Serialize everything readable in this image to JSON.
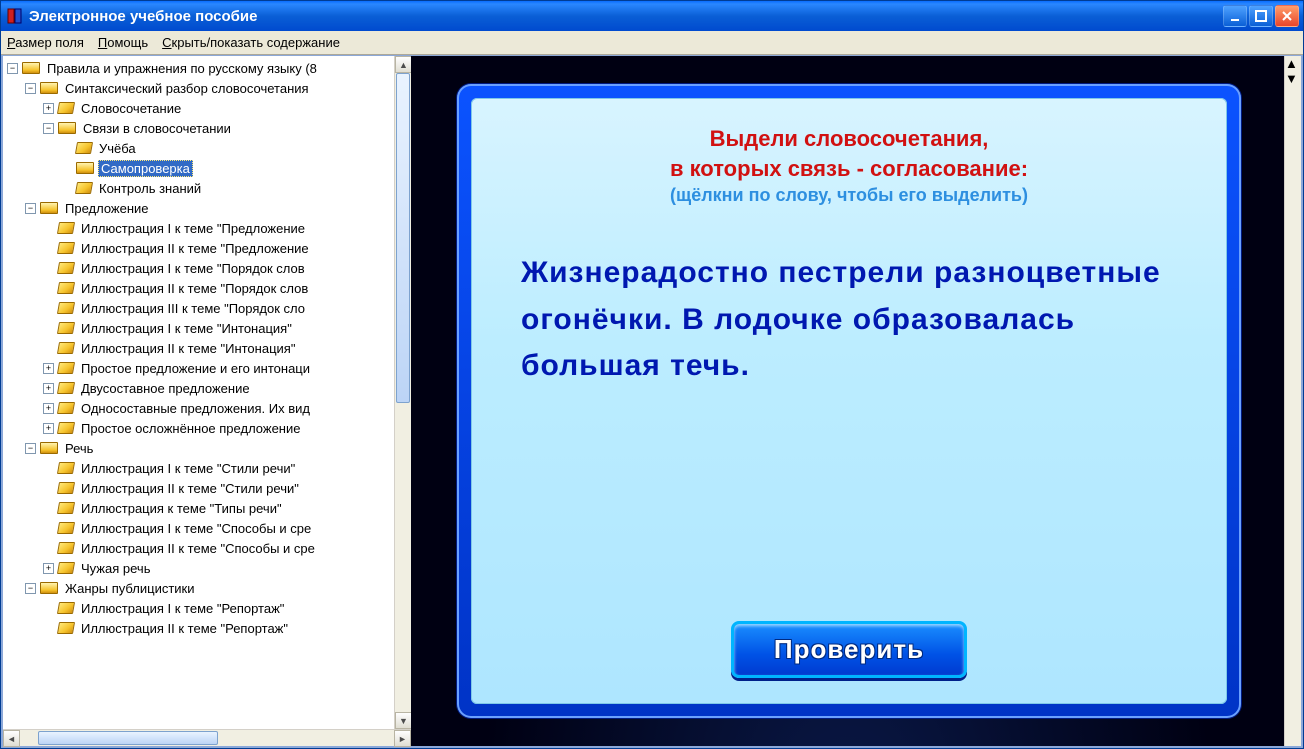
{
  "window": {
    "title": "Электронное учебное пособие"
  },
  "menu": {
    "field_size": "Размер поля",
    "help": "Помощь",
    "toggle_toc": "Скрыть/показать содержание"
  },
  "tree": {
    "root": {
      "label": "Правила и упражнения по русскому языку (8",
      "toggle": "−"
    },
    "syntax": {
      "label": "Синтаксический разбор словосочетания",
      "toggle": "−"
    },
    "slovosoch": {
      "label": "Словосочетание"
    },
    "svyazi": {
      "label": "Связи в словосочетании",
      "toggle": "−"
    },
    "ucheba": {
      "label": "Учёба"
    },
    "samoproverka": {
      "label": "Самопроверка"
    },
    "kontrol": {
      "label": "Контроль знаний"
    },
    "predlozhenie": {
      "label": "Предложение",
      "toggle": "−"
    },
    "ill1_pred": {
      "label": "Иллюстрация I к теме \"Предложение"
    },
    "ill2_pred": {
      "label": "Иллюстрация II к теме \"Предложение"
    },
    "ill1_por": {
      "label": "Иллюстрация I к теме \"Порядок слов"
    },
    "ill2_por": {
      "label": "Иллюстрация II к теме \"Порядок слов"
    },
    "ill3_por": {
      "label": "Иллюстрация III к теме \"Порядок сло"
    },
    "ill1_int": {
      "label": "Иллюстрация I к теме \"Интонация\""
    },
    "ill2_int": {
      "label": "Иллюстрация II к теме \"Интонация\""
    },
    "prostoe": {
      "label": "Простое предложение и его интонаци",
      "toggle": "+"
    },
    "dvusost": {
      "label": "Двусоставное предложение",
      "toggle": "+"
    },
    "odnosost": {
      "label": "Односоставные предложения. Их вид",
      "toggle": "+"
    },
    "oslozh": {
      "label": "Простое осложнённое предложение",
      "toggle": "+"
    },
    "rech": {
      "label": "Речь",
      "toggle": "−"
    },
    "ill1_stil": {
      "label": "Иллюстрация I к теме \"Стили речи\""
    },
    "ill2_stil": {
      "label": "Иллюстрация II к теме \"Стили речи\""
    },
    "ill_tipy": {
      "label": "Иллюстрация к теме \"Типы речи\""
    },
    "ill1_spos": {
      "label": "Иллюстрация I к теме \"Способы и сре"
    },
    "ill2_spos": {
      "label": "Иллюстрация II к теме \"Способы и сре"
    },
    "chuzhaya": {
      "label": "Чужая речь",
      "toggle": "+"
    },
    "zhanry": {
      "label": "Жанры публицистики",
      "toggle": "−"
    },
    "ill1_rep": {
      "label": "Иллюстрация I к теме \"Репортаж\""
    },
    "ill2_rep": {
      "label": "Иллюстрация II к теме \"Репортаж\""
    }
  },
  "content": {
    "instr_line1": "Выдели словосочетания,",
    "instr_line2": "в которых связь - согласование:",
    "instr_sub": "(щёлкни по слову, чтобы его выделить)",
    "task_text": "Жизнерадостно пестрели разноцветные огонёчки. В лодочке образовалась большая течь.",
    "check_btn": "Проверить"
  }
}
